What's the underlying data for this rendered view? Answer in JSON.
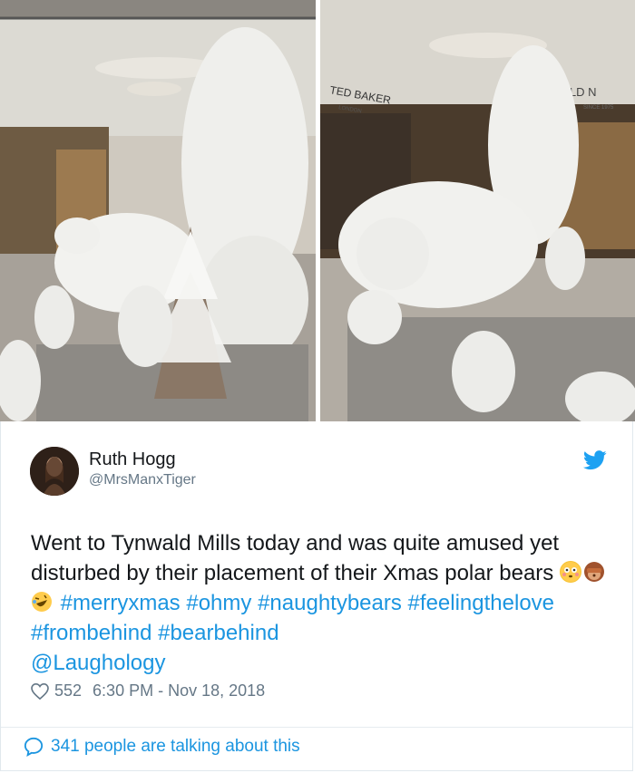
{
  "photos": {
    "left_alt": "polar bear display left",
    "right_alt": "polar bear display right",
    "store_sign_1": "TED BAKER",
    "store_sign_1_sub": "LONDON",
    "store_sign_2": "NWALD N",
    "store_sign_2_sub": "SINCE 1975"
  },
  "tweet": {
    "author_name": "Ruth Hogg",
    "author_handle": "@MrsManxTiger",
    "text_part1": "Went to Tynwald Mills today and was quite amused yet disturbed by their placement of their Xmas polar bears ",
    "hashtags": [
      "#merryxmas",
      "#ohmy",
      "#naughtybears",
      "#feelingthelove",
      "#frombehind",
      "#bearbehind"
    ],
    "mention": "@Laughology",
    "likes": "552",
    "timestamp": "6:30 PM - Nov 18, 2018",
    "talking": "341 people are talking about this"
  },
  "colors": {
    "link": "#1b95e0",
    "text": "#14171a",
    "muted": "#657786"
  },
  "icons": [
    "twitter-bird-icon",
    "heart-icon",
    "speech-bubble-icon"
  ]
}
